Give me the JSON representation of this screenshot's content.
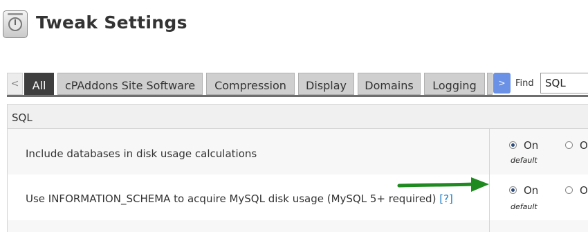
{
  "page": {
    "title": "Tweak Settings",
    "icon": "tweak-settings-icon"
  },
  "tabs": {
    "prev": "<",
    "next": ">",
    "items": [
      {
        "label": "All",
        "active": true
      },
      {
        "label": "cPAddons Site Software",
        "active": false
      },
      {
        "label": "Compression",
        "active": false
      },
      {
        "label": "Display",
        "active": false
      },
      {
        "label": "Domains",
        "active": false
      },
      {
        "label": "Logging",
        "active": false
      }
    ]
  },
  "find": {
    "label": "Find",
    "value": "SQL"
  },
  "section": {
    "title": "SQL"
  },
  "settings": [
    {
      "label": "Include databases in disk usage calculations",
      "on_label": "On",
      "off_label": "O",
      "selected": "on",
      "default_label": "default"
    },
    {
      "label": "Use INFORMATION_SCHEMA to acquire MySQL disk usage (MySQL 5+ required)",
      "help": "[?]",
      "on_label": "On",
      "off_label": "O",
      "selected": "on",
      "default_label": "default"
    }
  ],
  "colors": {
    "active_tab": "#3e3e3e",
    "tab": "#cfcfcf",
    "next_button": "#6a91e6",
    "arrow": "#1f8a1f",
    "link": "#1a7bc5"
  }
}
